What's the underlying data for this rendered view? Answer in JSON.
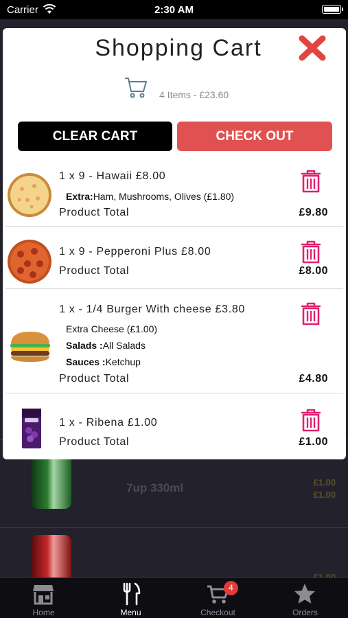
{
  "status_bar": {
    "carrier": "Carrier",
    "time": "2:30 AM"
  },
  "background_list": {
    "rows": [
      {
        "name": "7up 330ml",
        "prices": [
          "£1.00",
          "£1.00"
        ]
      },
      {
        "name": "",
        "prices": [
          "£1.00"
        ]
      }
    ]
  },
  "cart": {
    "title": "Shopping Cart",
    "summary": "4 Items - £23.60",
    "clear_label": "CLEAR CART",
    "checkout_label": "CHECK OUT",
    "total_label": "Product Total",
    "items": [
      {
        "title": "1 x 9 - Hawaii £8.00",
        "extra_label": "Extra:",
        "extra_value": "Ham, Mushrooms, Olives (£1.80)",
        "total": "£9.80"
      },
      {
        "title": "1 x 9 - Pepperoni Plus £8.00",
        "total": "£8.00"
      },
      {
        "title": "1 x - 1/4 Burger With cheese £3.80",
        "extra_line": "Extra Cheese (£1.00)",
        "salads_label": "Salads :",
        "salads_value": "All Salads",
        "sauces_label": "Sauces :",
        "sauces_value": "Ketchup",
        "total": "£4.80"
      },
      {
        "title": "1 x - Ribena £1.00",
        "total": "£1.00"
      }
    ]
  },
  "tab_bar": {
    "tabs": [
      {
        "label": "Home",
        "icon": "store-icon"
      },
      {
        "label": "Menu",
        "icon": "fork-knife-icon"
      },
      {
        "label": "Checkout",
        "icon": "cart-icon",
        "badge": "4"
      },
      {
        "label": "Orders",
        "icon": "star-icon"
      }
    ],
    "active": "Menu"
  },
  "colors": {
    "accent": "#e05252",
    "trash": "#e0206f",
    "close": "#e0463f",
    "badge": "#e53935"
  }
}
